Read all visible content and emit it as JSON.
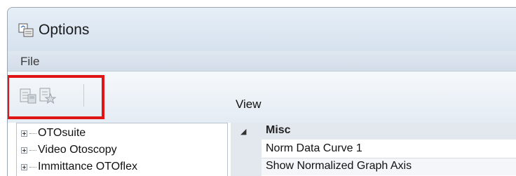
{
  "window": {
    "title": "Options"
  },
  "menu": {
    "file_label": "File"
  },
  "toolbar": {
    "buttons": [
      {
        "icon": "export-settings-icon"
      },
      {
        "icon": "favorites-icon"
      }
    ]
  },
  "panel": {
    "view_label": "View"
  },
  "tree": {
    "items": [
      {
        "label": "OTOsuite"
      },
      {
        "label": "Video Otoscopy"
      },
      {
        "label": "Immittance OTOflex"
      }
    ]
  },
  "property_grid": {
    "category": "Misc",
    "properties": [
      {
        "label": "Norm Data Curve 1"
      },
      {
        "label": "Show Normalized Graph Axis"
      }
    ]
  },
  "colors": {
    "highlight": "#e01616",
    "title_bg": "#dde6f0"
  }
}
